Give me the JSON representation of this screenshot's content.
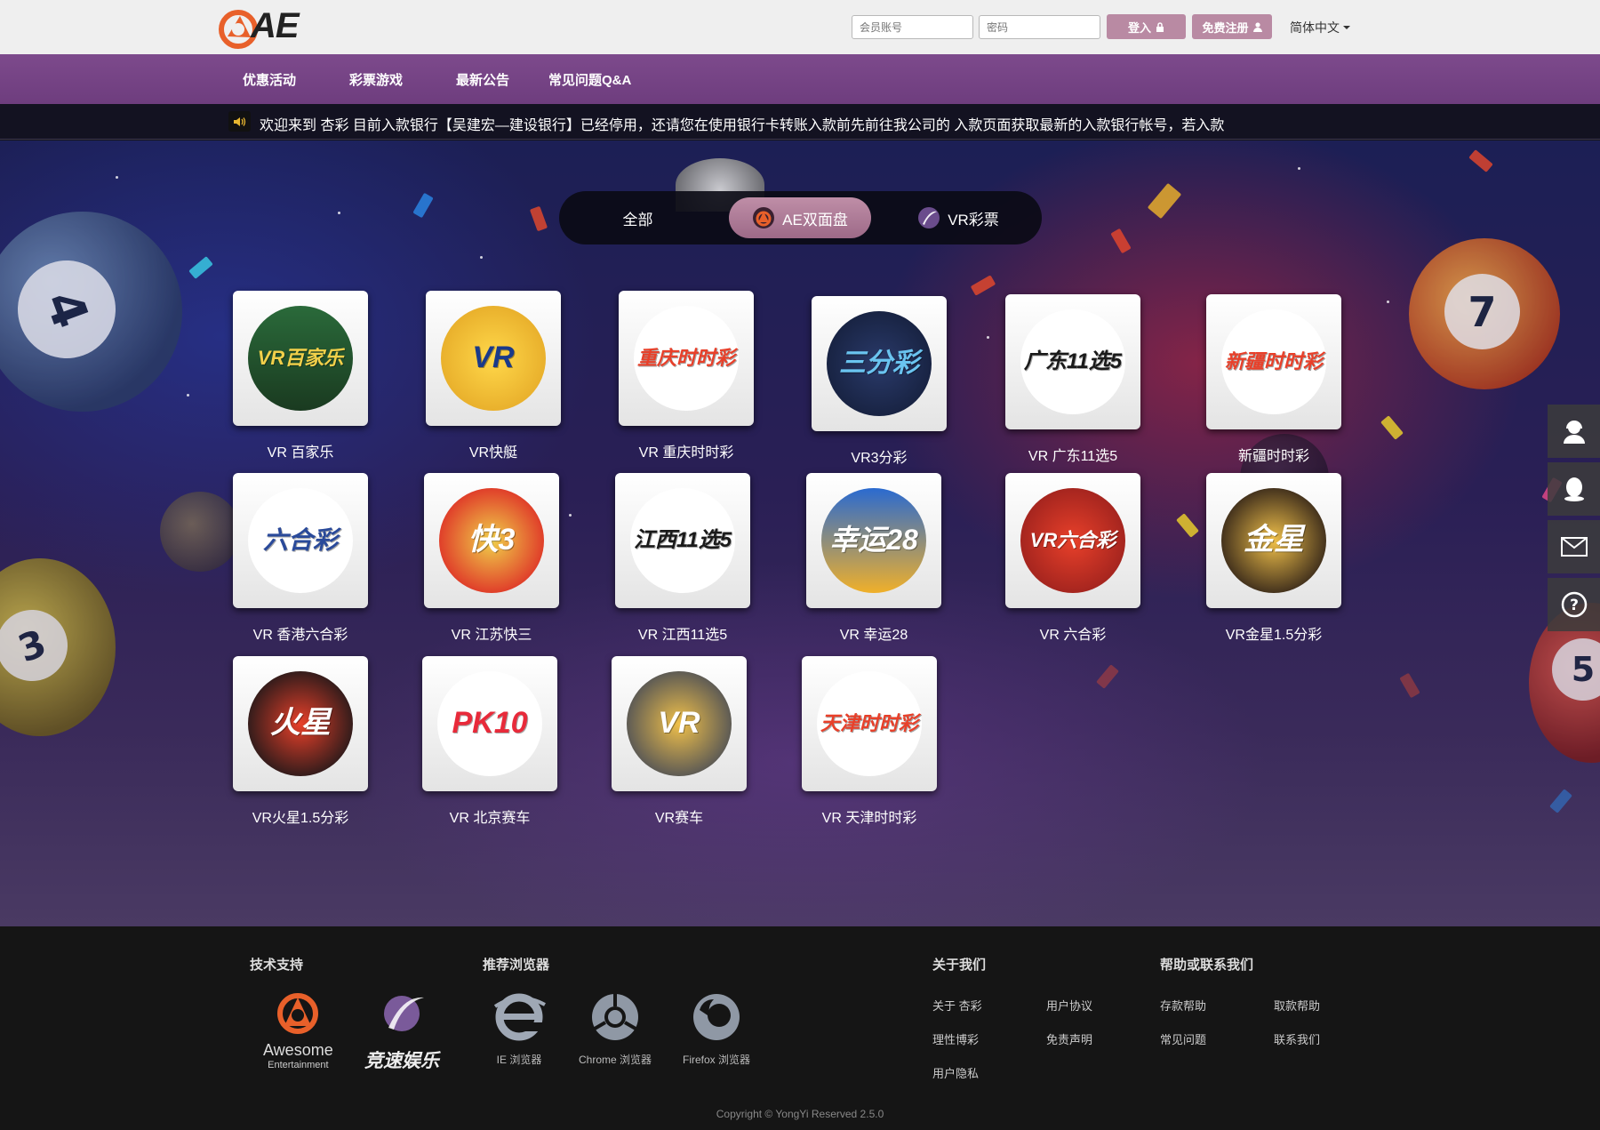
{
  "header": {
    "logo_text": "AE",
    "username_placeholder": "会员账号",
    "password_placeholder": "密码",
    "login_label": "登入",
    "register_label": "免费注册",
    "language": "简体中文"
  },
  "nav": {
    "items": [
      "优惠活动",
      "彩票游戏",
      "最新公告",
      "常见问题Q&A"
    ]
  },
  "ticker": {
    "text": "欢迎来到 杏彩    目前入款银行【吴建宏—建设银行】已经停用，还请您在使用银行卡转账入款前先前往我公司的 入款页面获取最新的入款银行帐号，若入款"
  },
  "tabs": {
    "all": "全部",
    "ae": "AE双面盘",
    "vr": "VR彩票"
  },
  "games": [
    {
      "label": "VR 百家乐",
      "tile_text": "VR百家乐"
    },
    {
      "label": "VR快艇",
      "tile_text": "VR"
    },
    {
      "label": "VR 重庆时时彩",
      "tile_text": "重庆时时彩"
    },
    {
      "label": "VR3分彩",
      "tile_text": "三分彩"
    },
    {
      "label": "VR 广东11选5",
      "tile_text": "广东11选5"
    },
    {
      "label": "新疆时时彩",
      "tile_text": "新疆时时彩"
    },
    {
      "label": "VR 香港六合彩",
      "tile_text": "六合彩"
    },
    {
      "label": "VR 江苏快三",
      "tile_text": "快3"
    },
    {
      "label": "VR 江西11选5",
      "tile_text": "江西11选5"
    },
    {
      "label": "VR 幸运28",
      "tile_text": "幸运28"
    },
    {
      "label": "VR 六合彩",
      "tile_text": "VR六合彩"
    },
    {
      "label": "VR金星1.5分彩",
      "tile_text": "金星"
    },
    {
      "label": "VR火星1.5分彩",
      "tile_text": "火星"
    },
    {
      "label": "VR 北京赛车",
      "tile_text": "PK10"
    },
    {
      "label": "VR赛车",
      "tile_text": "VR"
    },
    {
      "label": "VR 天津时时彩",
      "tile_text": "天津时时彩"
    }
  ],
  "balls": [
    "4",
    "3",
    "7",
    "5"
  ],
  "side_icons": [
    "customer-service-icon",
    "qq-icon",
    "mail-icon",
    "help-icon"
  ],
  "footer": {
    "tech_title": "技术支持",
    "tech_logos": [
      {
        "name": "Awesome",
        "sub": "Entertainment"
      },
      {
        "name": "竞速娱乐"
      }
    ],
    "browser_title": "推荐浏览器",
    "browsers": [
      "IE 浏览器",
      "Chrome 浏览器",
      "Firefox 浏览器"
    ],
    "about_title": "关于我们",
    "about_links": [
      "关于 杏彩",
      "用户协议",
      "理性博彩",
      "免责声明",
      "用户隐私"
    ],
    "help_title": "帮助或联系我们",
    "help_links": [
      "存款帮助",
      "取款帮助",
      "常见问题",
      "联系我们"
    ],
    "copyright": "Copyright © YongYi Reserved   2.5.0"
  }
}
